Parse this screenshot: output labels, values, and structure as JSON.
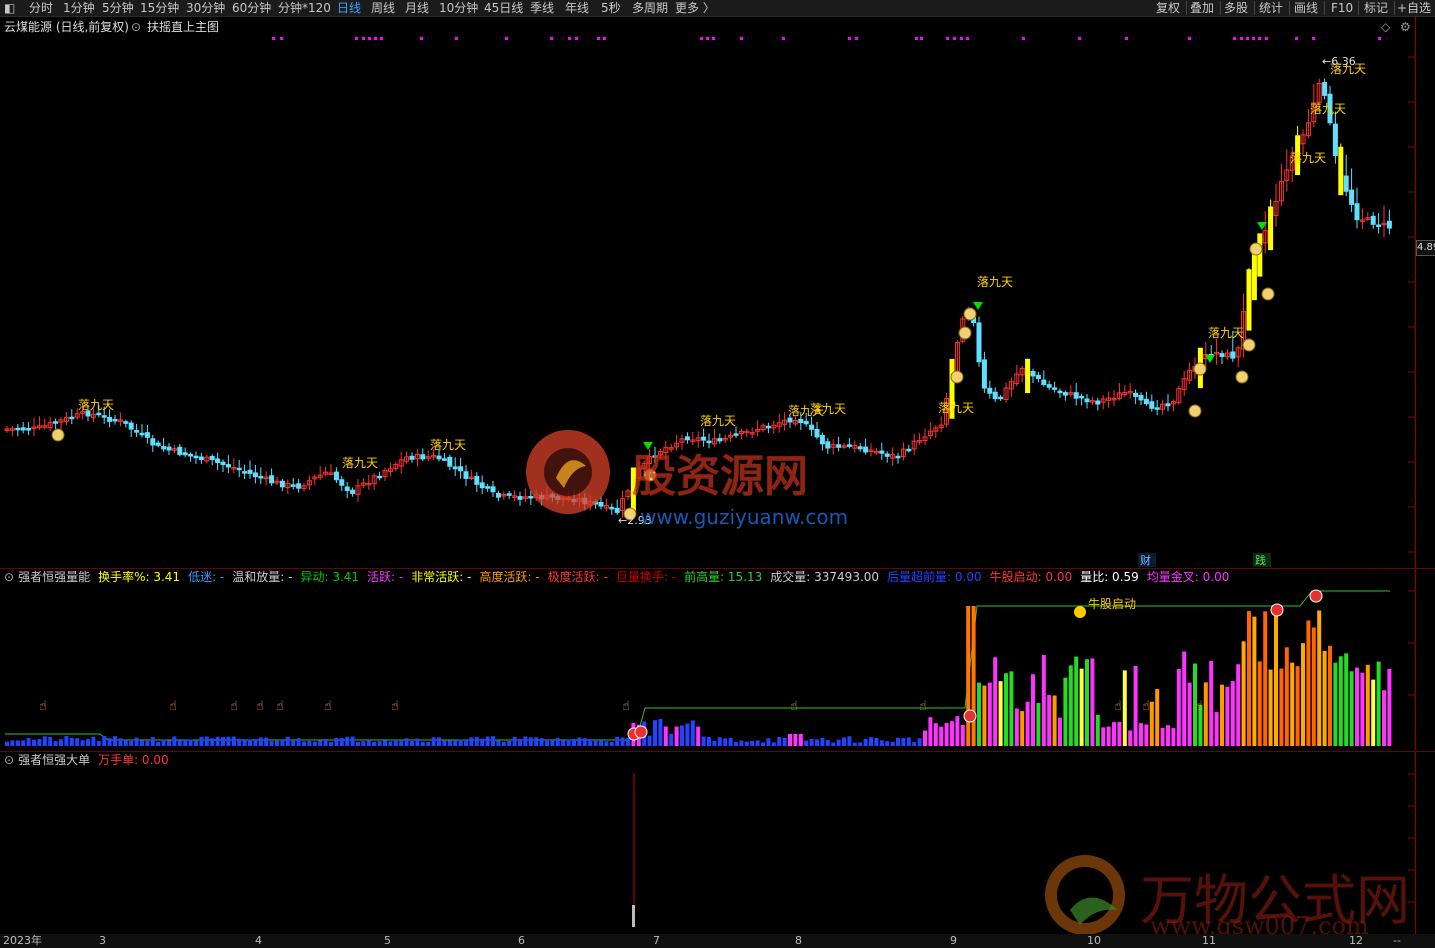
{
  "periods": [
    "分时",
    "1分钟",
    "5分钟",
    "15分钟",
    "30分钟",
    "60分钟",
    "分钟*120",
    "日线",
    "周线",
    "月线",
    "10分钟",
    "45日线",
    "季线",
    "年线",
    "5秒",
    "多周期",
    "更多 〉"
  ],
  "active_period": "日线",
  "right_tools": [
    "复权",
    "叠加",
    "多股",
    "统计",
    "画线",
    "F10",
    "标记",
    "+自选"
  ],
  "chart_title": "云煤能源 (日线,前复权)",
  "main_overlay_label": "扶摇直上主图",
  "price_high_label": "6.36",
  "price_low_label": "2.93",
  "current_price_tag": "4.89",
  "signal_label": "落九天",
  "sub_labels": {
    "cai": "财",
    "jian": "践"
  },
  "indicator1": {
    "name": "强者恒强量能",
    "fields": [
      {
        "label": "换手率%:",
        "value": "3.41",
        "color": "#ffff00"
      },
      {
        "label": "低迷:",
        "value": "-",
        "color": "#3399ff"
      },
      {
        "label": "温和放量:",
        "value": "-",
        "color": "#cccccc"
      },
      {
        "label": "异动:",
        "value": "3.41",
        "color": "#00cc00"
      },
      {
        "label": "活跃:",
        "value": "-",
        "color": "#ff33ff"
      },
      {
        "label": "非常活跃:",
        "value": "-",
        "color": "#ffff00"
      },
      {
        "label": "高度活跃:",
        "value": "-",
        "color": "#ff9900"
      },
      {
        "label": "极度活跃:",
        "value": "-",
        "color": "#ff3333"
      },
      {
        "label": "巨量换手:",
        "value": "-",
        "color": "#cc0000"
      },
      {
        "label": "前高量:",
        "value": "15.13",
        "color": "#33cc33"
      },
      {
        "label": "成交量:",
        "value": "337493.00",
        "color": "#cccccc"
      },
      {
        "label": "后量超前量:",
        "value": "0.00",
        "color": "#2244ff"
      },
      {
        "label": "牛股启动:",
        "value": "0.00",
        "color": "#ff3333"
      },
      {
        "label": "量比:",
        "value": "0.59",
        "color": "#ffffff"
      },
      {
        "label": "均量金叉:",
        "value": "0.00",
        "color": "#ff33ff"
      }
    ],
    "annotation": "牛股启动"
  },
  "indicator2": {
    "name": "强者恒强大单",
    "fields": [
      {
        "label": "万手单:",
        "value": "0.00",
        "color": "#ff3333"
      }
    ]
  },
  "date_labels": [
    "2023年",
    "3",
    "4",
    "5",
    "6",
    "7",
    "8",
    "9",
    "10",
    "11",
    "12",
    "--"
  ],
  "watermarks": {
    "site1_cn": "股资源网",
    "site1_url": "www.guziyuanw.com",
    "site2_cn": "万物公式网",
    "site2_url": "www.gsw007.com"
  },
  "colors": {
    "up": "#ff3333",
    "down": "#5fe0ff",
    "signal_bar": "#ffff00",
    "label": "#ffd000",
    "grid": "#5a0a0a"
  }
}
